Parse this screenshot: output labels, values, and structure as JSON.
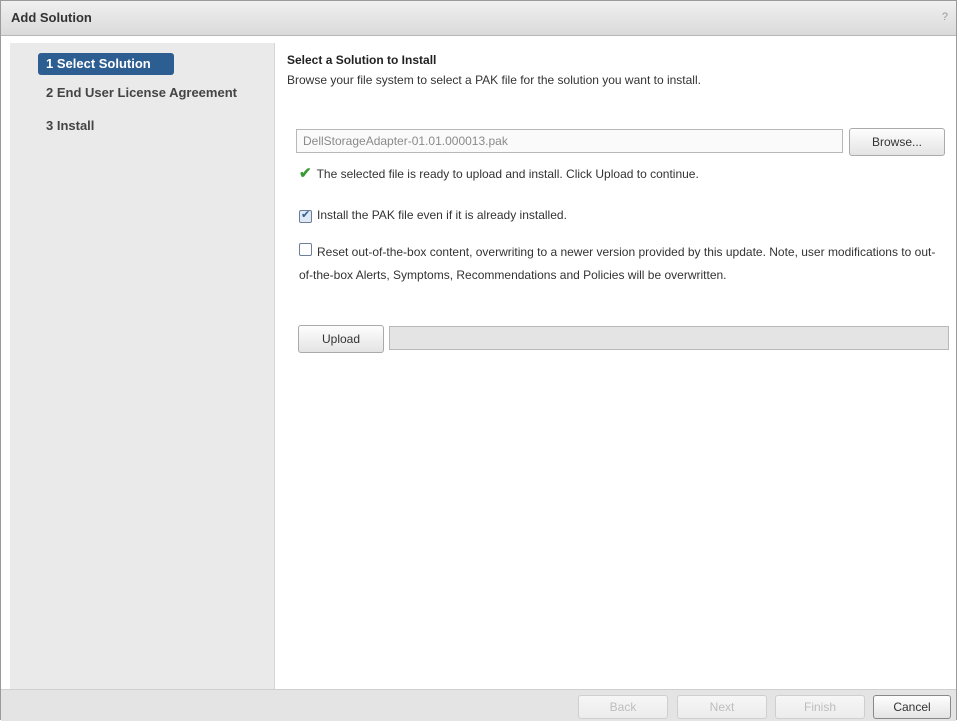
{
  "window": {
    "title": "Add Solution",
    "help": "?"
  },
  "steps": [
    {
      "label": "1  Select Solution",
      "active": true
    },
    {
      "label": "2  End User License Agreement",
      "active": false
    },
    {
      "label": "3  Install",
      "active": false
    }
  ],
  "main": {
    "heading": "Select a Solution to Install",
    "subtitle": "Browse your file system to select a PAK file for the solution you want to install.",
    "file_value": "DellStorageAdapter-01.01.000013.pak",
    "browse_label": "Browse...",
    "status_text": "The selected file is ready to upload and install. Click Upload to continue.",
    "checkbox_install": {
      "label": "Install the PAK file even if it is already installed.",
      "checked": true
    },
    "checkbox_reset": {
      "label": "Reset out-of-the-box content, overwriting to a newer version provided by this update. Note, user modifications to out-of-the-box Alerts, Symptoms, Recommendations and Policies will be overwritten.",
      "checked": false
    },
    "upload_label": "Upload",
    "upload_progress": 0
  },
  "footer": {
    "back": "Back",
    "next": "Next",
    "finish": "Finish",
    "cancel": "Cancel"
  },
  "colors": {
    "accent": "#2d5e92",
    "success": "#3c9a36",
    "sidebar_bg": "#eaeaea"
  }
}
